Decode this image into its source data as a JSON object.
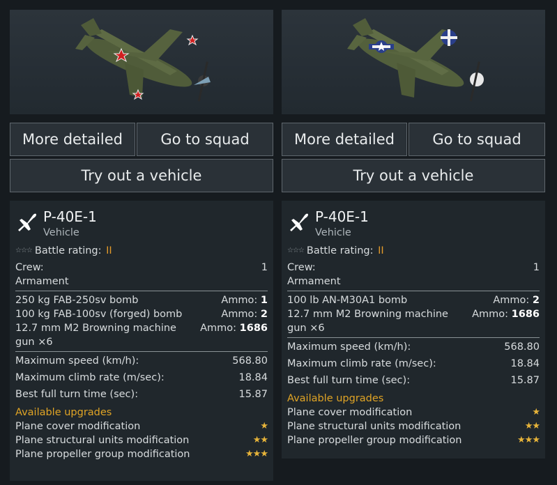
{
  "colors": {
    "accent_orange": "#e39a2a",
    "upgrade_title": "#e0a425",
    "star": "#e7b43a"
  },
  "columns": [
    {
      "buttons": {
        "detail": "More detailed",
        "squad": "Go to squad",
        "try": "Try out a vehicle"
      },
      "vehicle": {
        "name": "P-40E-1",
        "type": "Vehicle",
        "battle_rating_label": "Battle rating:",
        "battle_rating": "II",
        "crew_label": "Crew:",
        "crew": "1",
        "armament_label": "Armament",
        "armament": [
          {
            "name": "250 kg FAB-250sv bomb",
            "ammo_label": "Ammo:",
            "ammo": "1"
          },
          {
            "name": "100 kg FAB-100sv (forged) bomb",
            "ammo_label": "Ammo:",
            "ammo": "2"
          },
          {
            "name": "12.7 mm M2 Browning machine gun ×6",
            "ammo_label": "Ammo:",
            "ammo": "1686"
          }
        ],
        "stats": [
          {
            "label": "Maximum speed (km/h):",
            "value": "568.80"
          },
          {
            "label": "Maximum climb rate (m/sec):",
            "value": "18.84"
          },
          {
            "label": "Best full turn time (sec):",
            "value": "15.87"
          }
        ],
        "upgrades_title": "Available upgrades",
        "upgrades": [
          {
            "label": "Plane cover modification",
            "stars": 1
          },
          {
            "label": "Plane structural units modification",
            "stars": 2
          },
          {
            "label": "Plane propeller group modification",
            "stars": 3
          }
        ]
      }
    },
    {
      "buttons": {
        "detail": "More detailed",
        "squad": "Go to squad",
        "try": "Try out a vehicle"
      },
      "vehicle": {
        "name": "P-40E-1",
        "type": "Vehicle",
        "battle_rating_label": "Battle rating:",
        "battle_rating": "II",
        "crew_label": "Crew:",
        "crew": "1",
        "armament_label": "Armament",
        "armament": [
          {
            "name": "100 lb AN-M30A1 bomb",
            "ammo_label": "Ammo:",
            "ammo": "2"
          },
          {
            "name": "12.7 mm M2 Browning machine gun ×6",
            "ammo_label": "Ammo:",
            "ammo": "1686"
          }
        ],
        "stats": [
          {
            "label": "Maximum speed (km/h):",
            "value": "568.80"
          },
          {
            "label": "Maximum climb rate (m/sec):",
            "value": "18.84"
          },
          {
            "label": "Best full turn time (sec):",
            "value": "15.87"
          }
        ],
        "upgrades_title": "Available upgrades",
        "upgrades": [
          {
            "label": "Plane cover modification",
            "stars": 1
          },
          {
            "label": "Plane structural units modification",
            "stars": 2
          },
          {
            "label": "Plane propeller group modification",
            "stars": 3
          }
        ]
      }
    }
  ]
}
